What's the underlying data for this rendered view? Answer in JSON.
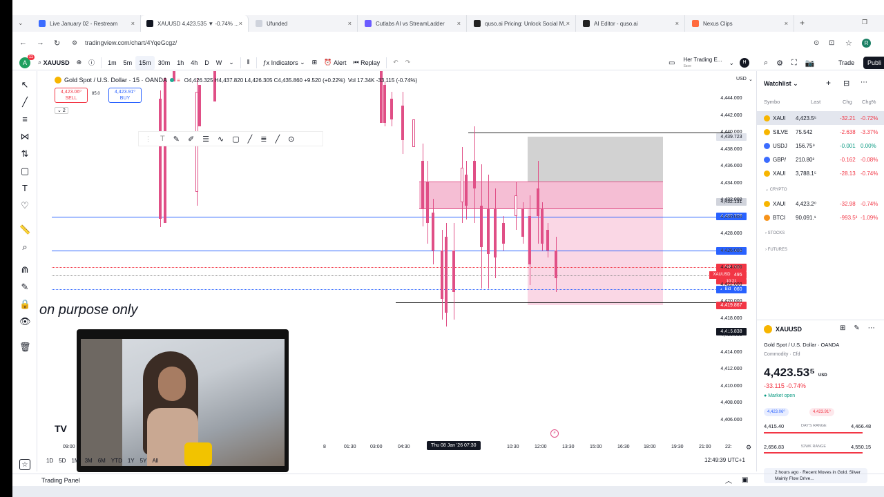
{
  "browser": {
    "tabs": [
      {
        "label": "Live January 02 - Restream",
        "color": "#3b6cff"
      },
      {
        "label": "XAUUSD 4,423.535 ▼ -0.74% ...",
        "color": "#131722",
        "active": true
      },
      {
        "label": "Ufunded",
        "color": "#cfd3dc"
      },
      {
        "label": "Cutlabs AI vs StreamLadder",
        "color": "#6b5cff"
      },
      {
        "label": "quso.ai Pricing: Unlock Social M...",
        "color": "#222"
      },
      {
        "label": "AI Editor - quso.ai",
        "color": "#222"
      },
      {
        "label": "Nexus Clips",
        "color": "#ff6a3d"
      }
    ],
    "url": "tradingview.com/chart/4YqeGcgz/",
    "new_tab": "+"
  },
  "toolbar": {
    "symbol": "XAUUSD",
    "intervals": [
      "1m",
      "5m",
      "15m",
      "30m",
      "1h",
      "4h",
      "D",
      "W"
    ],
    "active_interval": "15m",
    "indicators": "Indicators",
    "alert": "Alert",
    "replay": "Replay",
    "layout_name": "Her Trading E...",
    "layout_sub": "Save",
    "avatar": "H",
    "trade": "Trade",
    "publish": "Publi"
  },
  "chart": {
    "title": "Gold Spot / U.S. Dollar · 15 · OANDA",
    "ohlc": "O4,426.325 H4,437.820 L4,426.305 C4,435.860 +9.520 (+0.22%)",
    "vol": "Vol 17.34K -33.115 (-0.74%)",
    "sell_price": "4,423.06⁰",
    "sell_label": "SELL",
    "spread": "85.0",
    "buy_price": "4,423.91⁰",
    "buy_label": "BUY",
    "indicator_count": "2",
    "overlay_text": "on purpose only",
    "currency": "USD",
    "price_axis": [
      "4,444.000",
      "4,442.000",
      "4,440.000",
      "4,438.000",
      "4,436.000",
      "4,434.000",
      "4,432.000",
      "4,430.000",
      "4,428.000",
      "4,426.000",
      "4,424.000",
      "4,422.000",
      "4,420.000",
      "4,418.000",
      "4,416.000",
      "4,414.000",
      "4,412.000",
      "4,410.000",
      "4,408.000",
      "4,406.000"
    ],
    "price_labels": {
      "top_line": "4,439.723",
      "box_top": "4,432.131",
      "blue1": "4,430.309",
      "blue2": "4,426.309",
      "ask": "4,423.910",
      "last": "4,423.495",
      "countdown": "10:21",
      "bid": "4,423.060",
      "bottom_line": "4,419.867",
      "crosshair": "4,416.838"
    },
    "ask_tag": "Ask",
    "sym_tag": "XAUUSD",
    "bid_tag": "Bid",
    "time_axis": [
      "09:00",
      "8",
      "01:30",
      "03:00",
      "04:30",
      "10:30",
      "12:00",
      "13:30",
      "15:00",
      "16:30",
      "18:00",
      "19:30",
      "21:00",
      "22:"
    ],
    "crosshair_time": "Thu 08 Jan '26  07:30",
    "ranges": [
      "1D",
      "5D",
      "1M",
      "3M",
      "6M",
      "YTD",
      "1Y",
      "5Y",
      "All"
    ],
    "clock": "12:49:39 UTC+1"
  },
  "watchlist": {
    "title": "Watchlist",
    "headers": [
      "Symbo",
      "Last",
      "Chg",
      "Chg%"
    ],
    "rows": [
      {
        "sym": "XAUI",
        "last": "4,423.5⁵",
        "chg": "-32.21",
        "pct": "-0.72%",
        "dir": "neg",
        "selected": true
      },
      {
        "sym": "SILVE",
        "last": "75.542",
        "chg": "-2.638",
        "pct": "-3.37%",
        "dir": "neg"
      },
      {
        "sym": "USDJ",
        "last": "156.75⁹",
        "chg": "-0.001",
        "pct": "0.00%",
        "dir": "pos"
      },
      {
        "sym": "GBP/",
        "last": "210.80²",
        "chg": "-0.162",
        "pct": "-0.08%",
        "dir": "neg"
      },
      {
        "sym": "XAUI",
        "last": "3,788.1⁵",
        "chg": "-28.13",
        "pct": "-0.74%",
        "dir": "neg"
      }
    ],
    "crypto_label": "CRYPTO",
    "crypto_rows": [
      {
        "sym": "XAUI",
        "last": "4,423.2⁰",
        "chg": "-32.98",
        "pct": "-0.74%",
        "dir": "neg"
      },
      {
        "sym": "BTCI",
        "last": "90,091.¹",
        "chg": "-993.5³",
        "pct": "-1.09%",
        "dir": "neg"
      }
    ],
    "stocks_label": "STOCKS",
    "futures_label": "FUTURES"
  },
  "details": {
    "symbol": "XAUUSD",
    "name": "Gold Spot / U.S. Dollar · OANDA",
    "type": "Commodity · Cfd",
    "price": "4,423.53⁵",
    "currency": "USD",
    "change": "-33.115  -0.74%",
    "status": "Market open",
    "bid_pill": "4,423.06⁰",
    "ask_pill": "4,423.91⁰",
    "days_low": "4,415.40",
    "days_label": "DAY'S RANGE",
    "days_high": "4,466.48",
    "week_low": "2,656.83",
    "week_label": "52WK RANGE",
    "week_high": "4,550.15",
    "news": "2 hours ago · Recent Moves in Gold, Silver Mainly Flow Drive..."
  },
  "bottom": {
    "panel": "Trading Panel"
  },
  "colors": {
    "bear": "#e04f86",
    "blue_line": "#2962ff",
    "pink_zone": "#f3a6c6",
    "grey_zone": "#d0d0d0"
  }
}
